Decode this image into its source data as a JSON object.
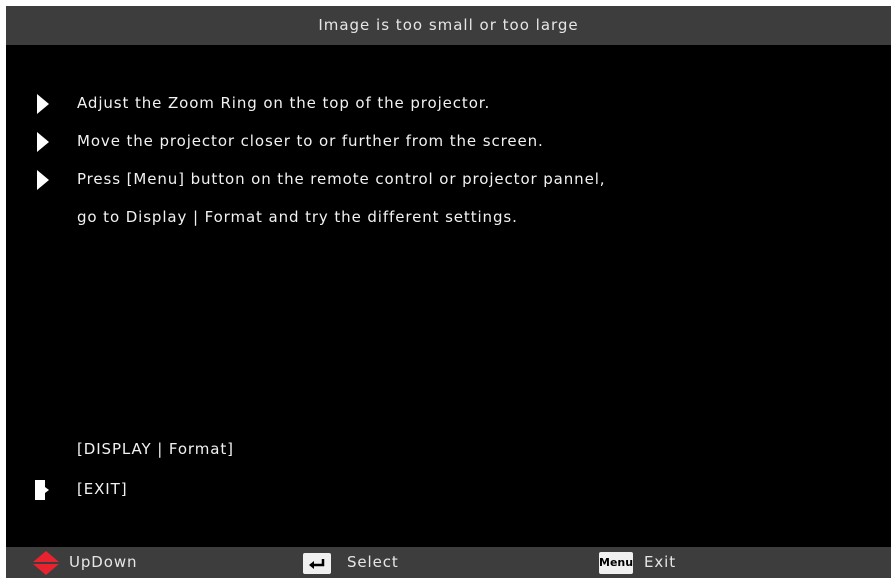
{
  "title": "Image is too small or too large",
  "instructions": [
    "Adjust the Zoom Ring on the top of the projector.",
    "Move the projector closer to or further from the screen.",
    "Press [Menu] button on the remote control or projector pannel,",
    "go to Display  |  Format and try the different settings."
  ],
  "shortcut": "[DISPLAY  |  Format]",
  "exit_label": "[EXIT]",
  "footer": {
    "updown_label": "UpDown",
    "select_label": "Select",
    "menu_key_label": "Menu",
    "exit_label": "Exit"
  },
  "colors": {
    "background": "#000000",
    "bar": "#3d3d3d",
    "text": "#f2f2f2",
    "updown_icon": "#e8232f"
  },
  "icons": [
    "play-bullet-icon",
    "exit-marker-icon",
    "updown-arrows-icon",
    "enter-key-icon",
    "menu-key-icon"
  ]
}
